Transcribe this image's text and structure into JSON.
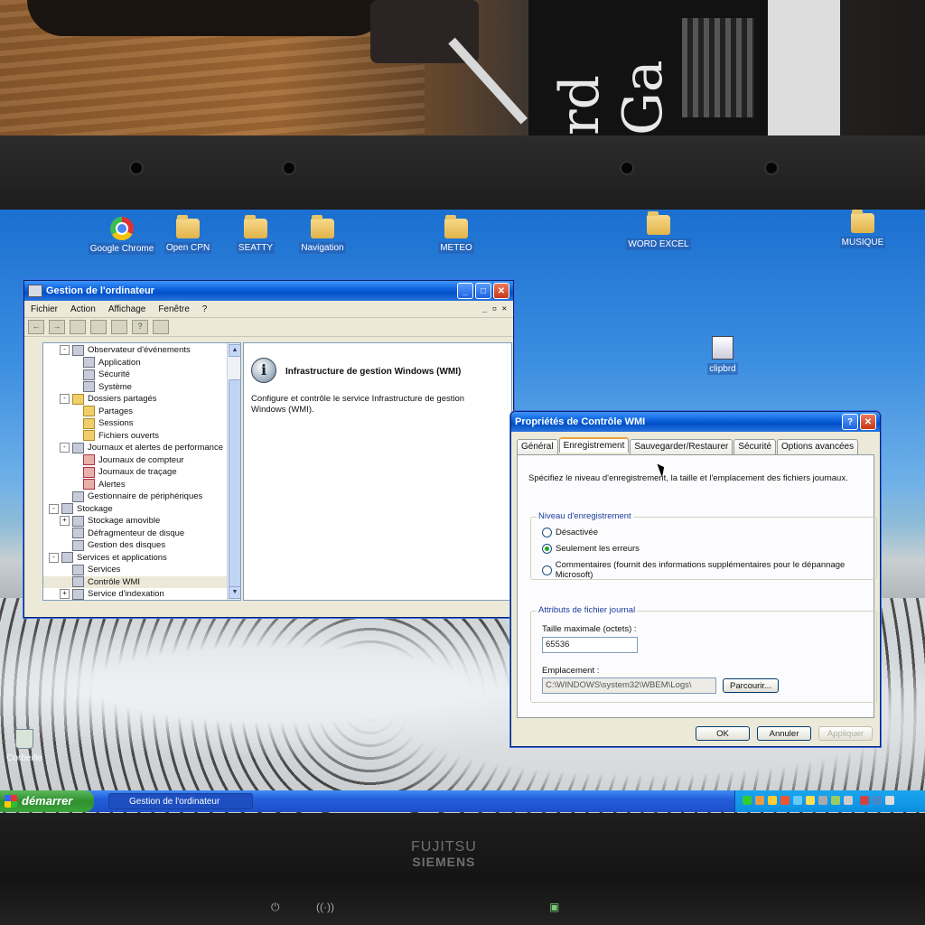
{
  "desktop": {
    "icons": [
      {
        "label": "Google Chrome",
        "type": "chrome"
      },
      {
        "label": "Open CPN",
        "type": "folder"
      },
      {
        "label": "SEATTY",
        "type": "folder"
      },
      {
        "label": "Navigation",
        "type": "folder"
      },
      {
        "label": "METEO",
        "type": "folder"
      },
      {
        "label": "WORD EXCEL",
        "type": "folder"
      },
      {
        "label": "MUSIQUE",
        "type": "folder"
      },
      {
        "label": "clipbrd",
        "type": "file"
      },
      {
        "label": "Corbeille",
        "type": "recycle-bin"
      }
    ]
  },
  "mgmt_window": {
    "title": "Gestion de l'ordinateur",
    "menu": [
      "Fichier",
      "Action",
      "Affichage",
      "Fenêtre",
      "?"
    ],
    "tree": [
      {
        "label": "Observateur d'événements",
        "level": 1,
        "exp": "-",
        "icon": "event-viewer"
      },
      {
        "label": "Application",
        "level": 2,
        "icon": "log"
      },
      {
        "label": "Sécurité",
        "level": 2,
        "icon": "log"
      },
      {
        "label": "Système",
        "level": 2,
        "icon": "log"
      },
      {
        "label": "Dossiers partagés",
        "level": 1,
        "exp": "-",
        "icon": "folder"
      },
      {
        "label": "Partages",
        "level": 2,
        "icon": "folder"
      },
      {
        "label": "Sessions",
        "level": 2,
        "icon": "folder"
      },
      {
        "label": "Fichiers ouverts",
        "level": 2,
        "icon": "folder"
      },
      {
        "label": "Journaux et alertes de performance",
        "level": 1,
        "exp": "-",
        "icon": "perf"
      },
      {
        "label": "Journaux de compteur",
        "level": 2,
        "icon": "red"
      },
      {
        "label": "Journaux de traçage",
        "level": 2,
        "icon": "red"
      },
      {
        "label": "Alertes",
        "level": 2,
        "icon": "red"
      },
      {
        "label": "Gestionnaire de périphériques",
        "level": 1,
        "icon": "device"
      },
      {
        "label": "Stockage",
        "level": 0,
        "exp": "-",
        "icon": "storage"
      },
      {
        "label": "Stockage amovible",
        "level": 1,
        "exp": "+",
        "icon": "storage"
      },
      {
        "label": "Défragmenteur de disque",
        "level": 1,
        "icon": "defrag"
      },
      {
        "label": "Gestion des disques",
        "level": 1,
        "icon": "disk"
      },
      {
        "label": "Services et applications",
        "level": 0,
        "exp": "-",
        "icon": "services"
      },
      {
        "label": "Services",
        "level": 1,
        "icon": "services"
      },
      {
        "label": "Contrôle WMI",
        "level": 1,
        "icon": "wmi",
        "selected": true
      },
      {
        "label": "Service d'indexation",
        "level": 1,
        "exp": "+",
        "icon": "index"
      }
    ],
    "right_title": "Infrastructure de gestion Windows (WMI)",
    "right_desc": "Configure et contrôle le service Infrastructure de gestion Windows (WMI)."
  },
  "wmi_dialog": {
    "title": "Propriétés de Contrôle WMI",
    "tabs": [
      "Général",
      "Enregistrement",
      "Sauvegarder/Restaurer",
      "Sécurité",
      "Options avancées"
    ],
    "active_tab": "Enregistrement",
    "intro": "Spécifiez le niveau d'enregistrement, la taille et l'emplacement des fichiers journaux.",
    "level_group": "Niveau d'enregistrement",
    "options": [
      {
        "label": "Désactivée",
        "checked": false
      },
      {
        "label": "Seulement les erreurs",
        "checked": true
      },
      {
        "label": "Commentaires (fournit des informations supplémentaires pour le dépannage Microsoft)",
        "checked": false
      }
    ],
    "file_group": "Attributs de fichier journal",
    "max_size_label": "Taille maximale (octets) :",
    "max_size_value": "65536",
    "location_label": "Emplacement :",
    "location_value": "C:\\WINDOWS\\system32\\WBEM\\Logs\\",
    "browse": "Parcourir...",
    "ok": "OK",
    "cancel": "Annuler",
    "apply": "Appliquer"
  },
  "taskbar": {
    "start": "démarrer",
    "item": "Gestion de l'ordinateur"
  },
  "laptop": {
    "brand_line1": "FUJITSU",
    "brand_line2": "SIEMENS"
  }
}
